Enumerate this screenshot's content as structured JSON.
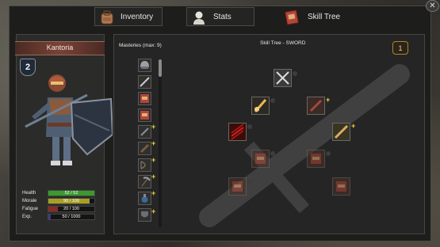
{
  "tabs": [
    {
      "label": "Inventory",
      "icon": "backpack-icon"
    },
    {
      "label": "Stats",
      "icon": "bust-icon"
    },
    {
      "label": "Skill Tree",
      "icon": "book-icon"
    }
  ],
  "character": {
    "name": "Kantoria",
    "level": "2",
    "stats": [
      {
        "label": "Health",
        "value": "52 / 52",
        "fraction": 1.0,
        "color": "#3a9a2e"
      },
      {
        "label": "Morale",
        "value": "90 / 100",
        "fraction": 0.9,
        "color": "#a8a024"
      },
      {
        "label": "Fatigue",
        "value": "20 / 100",
        "fraction": 0.2,
        "color": "#8a2a22"
      },
      {
        "label": "Exp.",
        "value": "50 / 1000",
        "fraction": 0.05,
        "color": "#3a3a8a"
      }
    ]
  },
  "skills": {
    "masteries_title": "Masteries (max: 9)",
    "tree_title": "Skill Tree - SWORD",
    "points": "1",
    "mastery_icons": [
      "helmet-icon",
      "sword-icon",
      "tome-icon",
      "tome-icon",
      "dagger-icon",
      "club-icon",
      "bow-icon",
      "pickaxe-icon",
      "potion-icon",
      "shield-icon"
    ]
  },
  "colors": {
    "accent": "#f2d43a",
    "panel": "#252525",
    "banner": "#7a4236"
  }
}
